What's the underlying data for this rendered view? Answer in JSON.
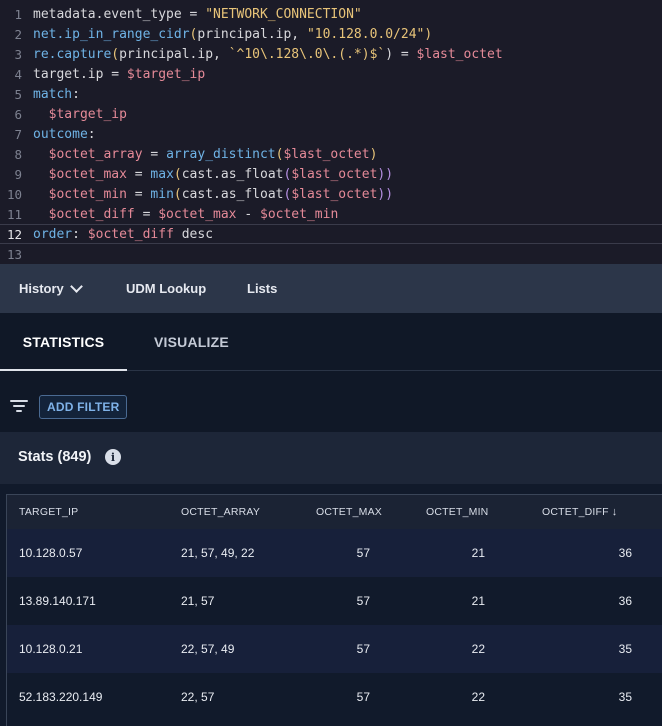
{
  "editor": {
    "lines": [
      {
        "n": "1",
        "tokens": [
          {
            "t": "metadata.event_type = ",
            "c": "t-id"
          },
          {
            "t": "\"NETWORK_CONNECTION\"",
            "c": "t-str"
          }
        ]
      },
      {
        "n": "2",
        "tokens": [
          {
            "t": "net.ip_in_range_cidr",
            "c": "t-fn"
          },
          {
            "t": "(",
            "c": "t-paren"
          },
          {
            "t": "principal.ip, ",
            "c": "t-id"
          },
          {
            "t": "\"10.128.0.0/24\"",
            "c": "t-str"
          },
          {
            "t": ")",
            "c": "t-paren"
          }
        ]
      },
      {
        "n": "3",
        "tokens": [
          {
            "t": "re.capture",
            "c": "t-fn"
          },
          {
            "t": "(",
            "c": "t-paren"
          },
          {
            "t": "principal.ip, ",
            "c": "t-id"
          },
          {
            "t": "`^10\\.128\\.0\\.(.*)$`",
            "c": "t-str"
          },
          {
            "t": ") = ",
            "c": "t-id"
          },
          {
            "t": "$last_octet",
            "c": "t-var"
          }
        ]
      },
      {
        "n": "4",
        "tokens": [
          {
            "t": "target.ip = ",
            "c": "t-id"
          },
          {
            "t": "$target_ip",
            "c": "t-var"
          }
        ]
      },
      {
        "n": "5",
        "tokens": [
          {
            "t": "match",
            "c": "t-fn"
          },
          {
            "t": ":",
            "c": "t-id"
          }
        ]
      },
      {
        "n": "6",
        "tokens": [
          {
            "t": "  ",
            "c": "t-id"
          },
          {
            "t": "$target_ip",
            "c": "t-var"
          }
        ]
      },
      {
        "n": "7",
        "tokens": [
          {
            "t": "outcome",
            "c": "t-fn"
          },
          {
            "t": ":",
            "c": "t-id"
          }
        ]
      },
      {
        "n": "8",
        "tokens": [
          {
            "t": "  ",
            "c": "t-id"
          },
          {
            "t": "$octet_array",
            "c": "t-var"
          },
          {
            "t": " = ",
            "c": "t-id"
          },
          {
            "t": "array_distinct",
            "c": "t-fn"
          },
          {
            "t": "(",
            "c": "t-paren"
          },
          {
            "t": "$last_octet",
            "c": "t-var"
          },
          {
            "t": ")",
            "c": "t-paren"
          }
        ]
      },
      {
        "n": "9",
        "tokens": [
          {
            "t": "  ",
            "c": "t-id"
          },
          {
            "t": "$octet_max",
            "c": "t-var"
          },
          {
            "t": " = ",
            "c": "t-id"
          },
          {
            "t": "max",
            "c": "t-fn"
          },
          {
            "t": "(",
            "c": "t-paren"
          },
          {
            "t": "cast.as_float",
            "c": "t-id"
          },
          {
            "t": "(",
            "c": "t-kw"
          },
          {
            "t": "$last_octet",
            "c": "t-var"
          },
          {
            "t": "))",
            "c": "t-kw"
          }
        ]
      },
      {
        "n": "10",
        "tokens": [
          {
            "t": "  ",
            "c": "t-id"
          },
          {
            "t": "$octet_min",
            "c": "t-var"
          },
          {
            "t": " = ",
            "c": "t-id"
          },
          {
            "t": "min",
            "c": "t-fn"
          },
          {
            "t": "(",
            "c": "t-paren"
          },
          {
            "t": "cast.as_float",
            "c": "t-id"
          },
          {
            "t": "(",
            "c": "t-kw"
          },
          {
            "t": "$last_octet",
            "c": "t-var"
          },
          {
            "t": "))",
            "c": "t-kw"
          }
        ]
      },
      {
        "n": "11",
        "tokens": [
          {
            "t": "  ",
            "c": "t-id"
          },
          {
            "t": "$octet_diff",
            "c": "t-var"
          },
          {
            "t": " = ",
            "c": "t-id"
          },
          {
            "t": "$octet_max",
            "c": "t-var"
          },
          {
            "t": " - ",
            "c": "t-id"
          },
          {
            "t": "$octet_min",
            "c": "t-var"
          }
        ]
      },
      {
        "n": "12",
        "tokens": [
          {
            "t": "order",
            "c": "t-fn"
          },
          {
            "t": ": ",
            "c": "t-id"
          },
          {
            "t": "$octet_diff",
            "c": "t-var"
          },
          {
            "t": " desc",
            "c": "t-id"
          }
        ]
      },
      {
        "n": "13",
        "tokens": []
      }
    ]
  },
  "toolbar": {
    "history_label": "History",
    "udm_lookup_label": "UDM Lookup",
    "lists_label": "Lists"
  },
  "tabs": {
    "statistics": "STATISTICS",
    "visualize": "VISUALIZE"
  },
  "filter": {
    "add_filter_label": "ADD FILTER"
  },
  "stats": {
    "title": "Stats (849)",
    "info_glyph": "i"
  },
  "table": {
    "columns": [
      "TARGET_IP",
      "OCTET_ARRAY",
      "OCTET_MAX",
      "OCTET_MIN",
      "OCTET_DIFF"
    ],
    "sort_glyph": "↓",
    "rows": [
      [
        "10.128.0.57",
        "21, 57, 49, 22",
        "57",
        "21",
        "36"
      ],
      [
        "13.89.140.171",
        "21, 57",
        "57",
        "21",
        "36"
      ],
      [
        "10.128.0.21",
        "22, 57, 49",
        "57",
        "22",
        "35"
      ],
      [
        "52.183.220.149",
        "22, 57",
        "57",
        "22",
        "35"
      ]
    ]
  }
}
